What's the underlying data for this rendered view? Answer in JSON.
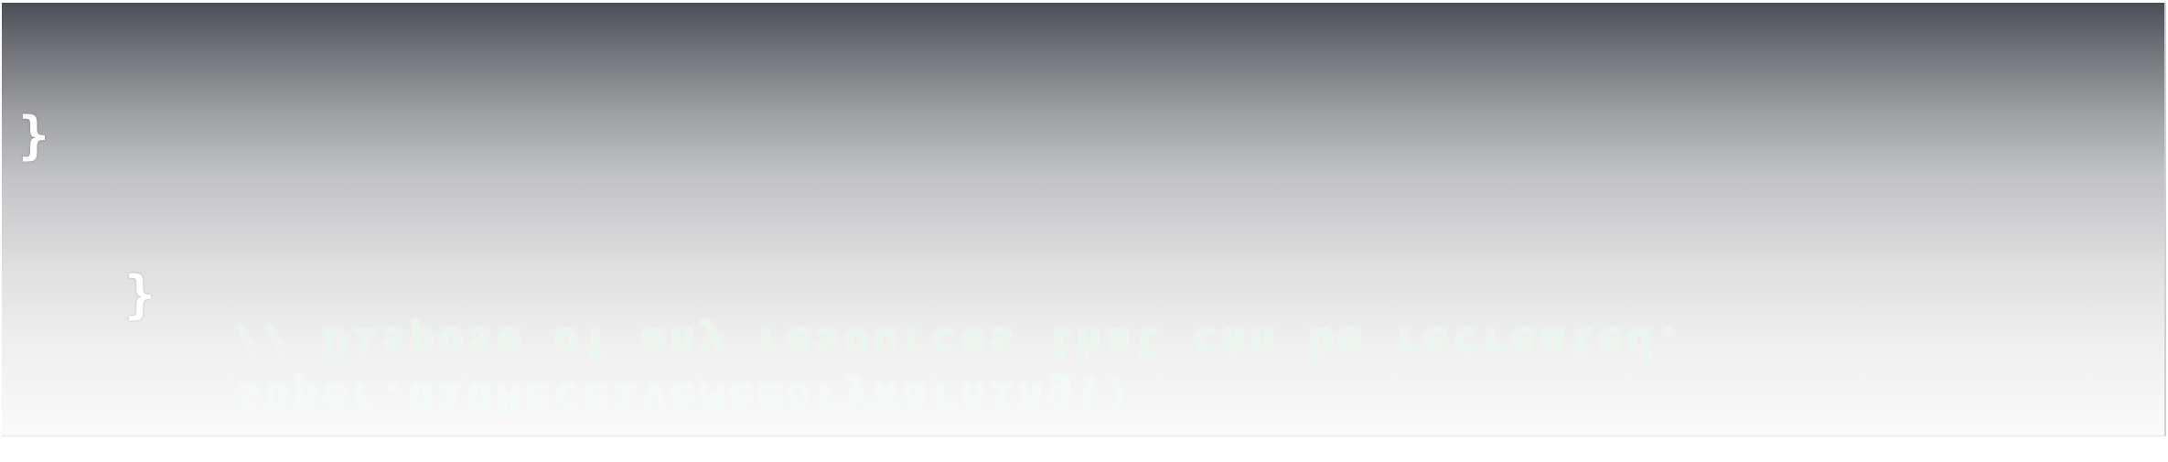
{
  "editor": {
    "closing_brace_outer": "}",
    "closing_brace_inner": "}",
    "reflected_comment": "// Dispose of any resources that can be recreated.",
    "reflected_call": "super.didReceiveMemoryWarning()"
  },
  "colors": {
    "gradient_top": "#4b4e55",
    "gradient_bottom": "#fafafa",
    "brace": "#ffffff",
    "reflection_text": "#e8f5ec"
  }
}
